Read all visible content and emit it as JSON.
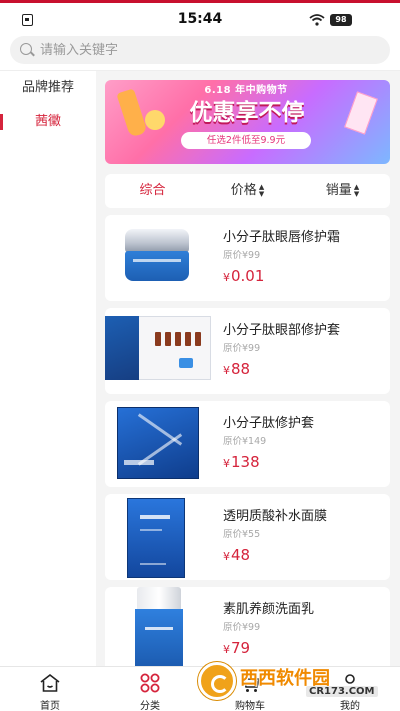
{
  "status_bar": {
    "time": "15:44",
    "battery": "98"
  },
  "search": {
    "placeholder": "请输入关键字"
  },
  "sidebar": {
    "items": [
      {
        "label": "品牌推荐"
      },
      {
        "label": "茜黴"
      }
    ]
  },
  "banner": {
    "top_text": "6.18 年中购物节",
    "title": "优惠享不停",
    "subtitle": "任选2件低至9.9元"
  },
  "sort_bar": {
    "items": [
      {
        "label": "综合"
      },
      {
        "label": "价格"
      },
      {
        "label": "销量"
      }
    ]
  },
  "products": [
    {
      "name": "小分子肽眼唇修护霜",
      "original_price": "原价¥99",
      "currency": "¥",
      "price": "0.01"
    },
    {
      "name": "小分子肽眼部修护套",
      "original_price": "原价¥99",
      "currency": "¥",
      "price": "88"
    },
    {
      "name": "小分子肽修护套",
      "original_price": "原价¥149",
      "currency": "¥",
      "price": "138"
    },
    {
      "name": "透明质酸补水面膜",
      "original_price": "原价¥55",
      "currency": "¥",
      "price": "48"
    },
    {
      "name": "素肌养颜洗面乳",
      "original_price": "原价¥99",
      "currency": "¥",
      "price": "79"
    }
  ],
  "bottom_nav": {
    "items": [
      {
        "label": "首页",
        "icon": "home-icon"
      },
      {
        "label": "分类",
        "icon": "category-icon"
      },
      {
        "label": "购物车",
        "icon": "cart-icon"
      },
      {
        "label": "我的",
        "icon": "profile-icon"
      }
    ]
  },
  "watermark": {
    "text": "西西软件园",
    "url": "CR173.COM"
  },
  "colors": {
    "accent": "#d5243c",
    "status_bar_line": "#c8102e"
  }
}
